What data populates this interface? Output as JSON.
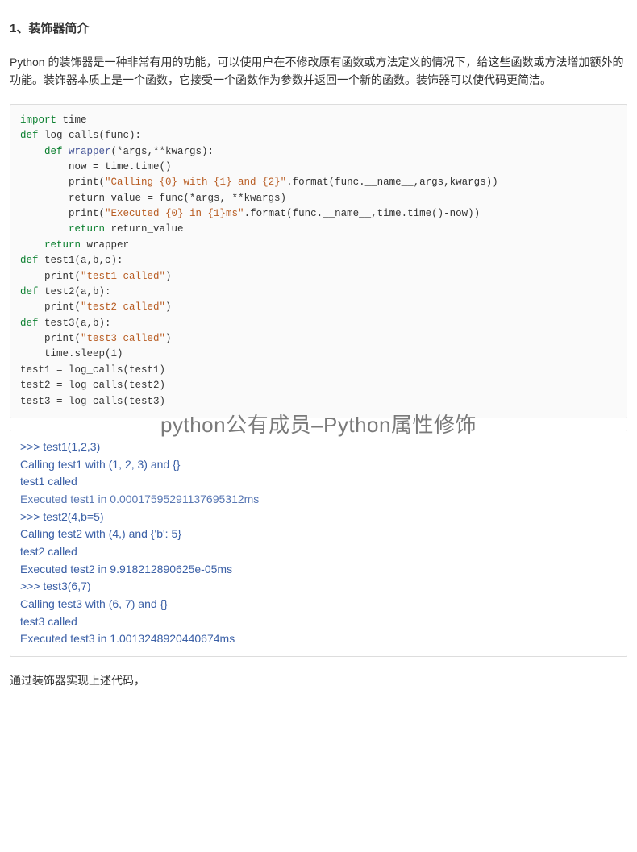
{
  "heading": "1、装饰器简介",
  "intro": "Python 的装饰器是一种非常有用的功能，可以使用户在不修改原有函数或方法定义的情况下，给这些函数或方法增加额外的功能。装饰器本质上是一个函数，它接受一个函数作为参数并返回一个新的函数。装饰器可以使代码更简洁。",
  "code": {
    "l01a": "import",
    "l01b": " time",
    "l02a": "def",
    "l02b": " log_calls(func):",
    "l03a": "    def",
    "l03b": " wrapper",
    "l03c": "(*args,**kwargs):",
    "l04": "        now = time.time()",
    "l05a": "        print(",
    "l05b": "\"Calling {0} with {1} and {2}\"",
    "l05c": ".format(func.__name__,args,kwargs))",
    "l06": "        return_value = func(*args, **kwargs)",
    "l07a": "        print(",
    "l07b": "\"Executed {0} in {1}ms\"",
    "l07c": ".format(func.__name__,time.time()-now))",
    "l08a": "        return",
    "l08b": " return_value",
    "l09a": "    return",
    "l09b": " wrapper",
    "l10a": "def",
    "l10b": " test1(a,b,c):",
    "l11a": "    print(",
    "l11b": "\"test1 called\"",
    "l11c": ")",
    "l12a": "def",
    "l12b": " test2(a,b):",
    "l13a": "    print(",
    "l13b": "\"test2 called\"",
    "l13c": ")",
    "l14a": "def",
    "l14b": " test3(a,b):",
    "l15a": "    print(",
    "l15b": "\"test3 called\"",
    "l15c": ")",
    "l16": "    time.sleep(1)",
    "l17": "test1 = log_calls(test1)",
    "l18": "test2 = log_calls(test2)",
    "l19": "test3 = log_calls(test3)"
  },
  "output": [
    ">>> test1(1,2,3)",
    "Calling test1 with (1, 2, 3) and {}",
    "test1 called",
    "Executed test1 in 0.00017595291137695312ms",
    ">>> test2(4,b=5)",
    "Calling test2 with (4,) and {'b': 5}",
    "test2 called",
    "Executed test2 in 9.918212890625e-05ms",
    ">>> test3(6,7)",
    "Calling test3 with (6, 7) and {}",
    "test3 called",
    "Executed test3 in 1.0013248920440674ms"
  ],
  "outro": "通过装饰器实现上述代码，",
  "watermark": "python公有成员–Python属性修饰"
}
